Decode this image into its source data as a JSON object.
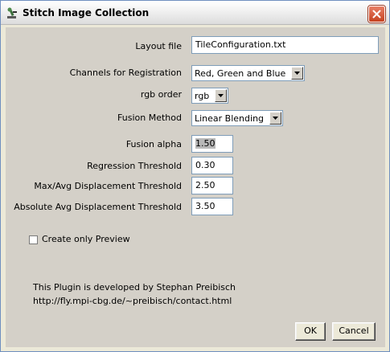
{
  "window": {
    "title": "Stitch Image Collection",
    "app_icon": "imagej-microscope-icon",
    "close_icon": "close-icon"
  },
  "form": {
    "layout_file": {
      "label": "Layout file",
      "value": "TileConfiguration.txt"
    },
    "channels": {
      "label": "Channels for Registration",
      "value": "Red, Green and Blue"
    },
    "rgb_order": {
      "label": "rgb order",
      "value": "rgb"
    },
    "fusion_method": {
      "label": "Fusion Method",
      "value": "Linear Blending"
    },
    "fusion_alpha": {
      "label": "Fusion alpha",
      "value": "1.50"
    },
    "regression_threshold": {
      "label": "Regression Threshold",
      "value": "0.30"
    },
    "max_avg_displacement": {
      "label": "Max/Avg Displacement Threshold",
      "value": "2.50"
    },
    "abs_avg_displacement": {
      "label": "Absolute Avg Displacement Threshold",
      "value": "3.50"
    },
    "preview": {
      "label": "Create only Preview",
      "checked": false
    }
  },
  "info": {
    "line1": "This Plugin is developed by Stephan Preibisch",
    "line2": "http://fly.mpi-cbg.de/~preibisch/contact.html"
  },
  "buttons": {
    "ok": "OK",
    "cancel": "Cancel"
  },
  "colors": {
    "dialog_bg": "#d4d0c8",
    "field_border": "#7f9db9",
    "close_button": "#c6411f"
  }
}
